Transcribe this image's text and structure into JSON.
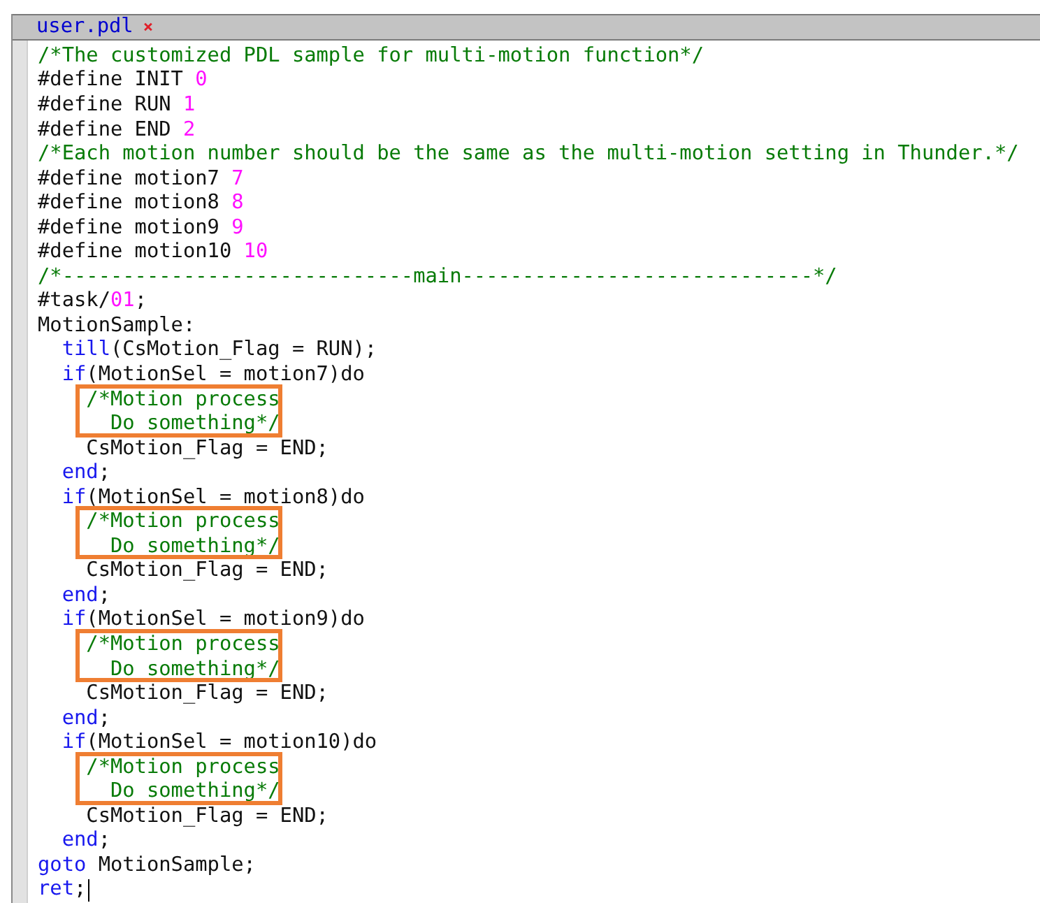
{
  "tab": {
    "title": "user.pdl",
    "close": "×",
    "selected": true
  },
  "lines": [
    {
      "highlight": false,
      "caret": false,
      "tokens": [
        {
          "kind": "comment",
          "text": "/*The customized PDL sample for multi-motion function*/"
        }
      ]
    },
    {
      "highlight": false,
      "caret": false,
      "tokens": [
        {
          "kind": "plain",
          "text": "#define INIT "
        },
        {
          "kind": "number",
          "text": "0"
        }
      ]
    },
    {
      "highlight": false,
      "caret": false,
      "tokens": [
        {
          "kind": "plain",
          "text": "#define RUN "
        },
        {
          "kind": "number",
          "text": "1"
        }
      ]
    },
    {
      "highlight": false,
      "caret": false,
      "tokens": [
        {
          "kind": "plain",
          "text": "#define END "
        },
        {
          "kind": "number",
          "text": "2"
        }
      ]
    },
    {
      "highlight": false,
      "caret": false,
      "tokens": [
        {
          "kind": "comment",
          "text": "/*Each motion number should be the same as the multi-motion setting in Thunder.*/"
        }
      ]
    },
    {
      "highlight": false,
      "caret": false,
      "tokens": [
        {
          "kind": "plain",
          "text": "#define motion7 "
        },
        {
          "kind": "number",
          "text": "7"
        }
      ]
    },
    {
      "highlight": false,
      "caret": false,
      "tokens": [
        {
          "kind": "plain",
          "text": "#define motion8 "
        },
        {
          "kind": "number",
          "text": "8"
        }
      ]
    },
    {
      "highlight": false,
      "caret": false,
      "tokens": [
        {
          "kind": "plain",
          "text": "#define motion9 "
        },
        {
          "kind": "number",
          "text": "9"
        }
      ]
    },
    {
      "highlight": false,
      "caret": false,
      "tokens": [
        {
          "kind": "plain",
          "text": "#define motion10 "
        },
        {
          "kind": "number",
          "text": "10"
        }
      ]
    },
    {
      "highlight": false,
      "caret": false,
      "tokens": [
        {
          "kind": "comment",
          "text": "/*-----------------------------main-----------------------------*/"
        }
      ]
    },
    {
      "highlight": false,
      "caret": false,
      "tokens": [
        {
          "kind": "plain",
          "text": "#task/"
        },
        {
          "kind": "number",
          "text": "01"
        },
        {
          "kind": "plain",
          "text": ";"
        }
      ]
    },
    {
      "highlight": false,
      "caret": false,
      "tokens": [
        {
          "kind": "plain",
          "text": "MotionSample:"
        }
      ]
    },
    {
      "highlight": false,
      "caret": false,
      "tokens": [
        {
          "kind": "keyword",
          "text": "  till"
        },
        {
          "kind": "plain",
          "text": "(CsMotion_Flag = RUN);"
        }
      ]
    },
    {
      "highlight": false,
      "caret": false,
      "tokens": [
        {
          "kind": "keyword",
          "text": "  if"
        },
        {
          "kind": "plain",
          "text": "(MotionSel = motion7)do"
        }
      ]
    },
    {
      "highlight": true,
      "caret": false,
      "tokens": [
        {
          "kind": "comment",
          "text": "    /*Motion process"
        }
      ]
    },
    {
      "highlight": true,
      "caret": false,
      "tokens": [
        {
          "kind": "comment",
          "text": "      Do something*/"
        }
      ]
    },
    {
      "highlight": false,
      "caret": false,
      "tokens": [
        {
          "kind": "plain",
          "text": "    CsMotion_Flag = END;"
        }
      ]
    },
    {
      "highlight": false,
      "caret": false,
      "tokens": [
        {
          "kind": "keyword",
          "text": "  end"
        },
        {
          "kind": "plain",
          "text": ";"
        }
      ]
    },
    {
      "highlight": false,
      "caret": false,
      "tokens": [
        {
          "kind": "keyword",
          "text": "  if"
        },
        {
          "kind": "plain",
          "text": "(MotionSel = motion8)do"
        }
      ]
    },
    {
      "highlight": true,
      "caret": false,
      "tokens": [
        {
          "kind": "comment",
          "text": "    /*Motion process"
        }
      ]
    },
    {
      "highlight": true,
      "caret": false,
      "tokens": [
        {
          "kind": "comment",
          "text": "      Do something*/"
        }
      ]
    },
    {
      "highlight": false,
      "caret": false,
      "tokens": [
        {
          "kind": "plain",
          "text": "    CsMotion_Flag = END;"
        }
      ]
    },
    {
      "highlight": false,
      "caret": false,
      "tokens": [
        {
          "kind": "keyword",
          "text": "  end"
        },
        {
          "kind": "plain",
          "text": ";"
        }
      ]
    },
    {
      "highlight": false,
      "caret": false,
      "tokens": [
        {
          "kind": "keyword",
          "text": "  if"
        },
        {
          "kind": "plain",
          "text": "(MotionSel = motion9)do"
        }
      ]
    },
    {
      "highlight": true,
      "caret": false,
      "tokens": [
        {
          "kind": "comment",
          "text": "    /*Motion process"
        }
      ]
    },
    {
      "highlight": true,
      "caret": false,
      "tokens": [
        {
          "kind": "comment",
          "text": "      Do something*/"
        }
      ]
    },
    {
      "highlight": false,
      "caret": false,
      "tokens": [
        {
          "kind": "plain",
          "text": "    CsMotion_Flag = END;"
        }
      ]
    },
    {
      "highlight": false,
      "caret": false,
      "tokens": [
        {
          "kind": "keyword",
          "text": "  end"
        },
        {
          "kind": "plain",
          "text": ";"
        }
      ]
    },
    {
      "highlight": false,
      "caret": false,
      "tokens": [
        {
          "kind": "keyword",
          "text": "  if"
        },
        {
          "kind": "plain",
          "text": "(MotionSel = motion10)do"
        }
      ]
    },
    {
      "highlight": true,
      "caret": false,
      "tokens": [
        {
          "kind": "comment",
          "text": "    /*Motion process"
        }
      ]
    },
    {
      "highlight": true,
      "caret": false,
      "tokens": [
        {
          "kind": "comment",
          "text": "      Do something*/"
        }
      ]
    },
    {
      "highlight": false,
      "caret": false,
      "tokens": [
        {
          "kind": "plain",
          "text": "    CsMotion_Flag = END;"
        }
      ]
    },
    {
      "highlight": false,
      "caret": false,
      "tokens": [
        {
          "kind": "keyword",
          "text": "  end"
        },
        {
          "kind": "plain",
          "text": ";"
        }
      ]
    },
    {
      "highlight": false,
      "caret": false,
      "tokens": [
        {
          "kind": "keyword",
          "text": "goto"
        },
        {
          "kind": "plain",
          "text": " MotionSample;"
        }
      ]
    },
    {
      "highlight": false,
      "caret": true,
      "tokens": [
        {
          "kind": "keyword",
          "text": "ret"
        },
        {
          "kind": "plain",
          "text": ";"
        }
      ]
    }
  ]
}
